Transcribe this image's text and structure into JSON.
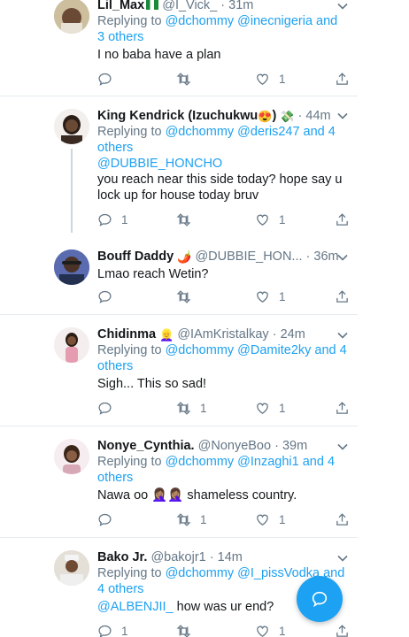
{
  "tweets": [
    {
      "name": "Lil_Max",
      "name_emoji": "🇳🇬",
      "handle": "@I_Vick_",
      "time": "31m",
      "reply_prefix": "Replying to ",
      "reply_links": "@dchommy @inecnigeria and 3 others",
      "mention": "",
      "text": "I no baba have a plan",
      "reply_count": "",
      "retweet_count": "",
      "like_count": "1"
    },
    {
      "name": "King Kendrick (Izuchukwu",
      "name_emoji": "😍",
      "name_suffix": ")",
      "name_emoji2": "💸",
      "handle": "",
      "time": "44m",
      "reply_prefix": "Replying to ",
      "reply_links": "@dchommy @deris247 and 4 others",
      "mention": "@DUBBIE_HONCHO",
      "text": "you reach near this side today? hope say u lock up for house today bruv",
      "reply_count": "1",
      "retweet_count": "",
      "like_count": "1"
    },
    {
      "name": "Bouff Daddy",
      "name_emoji": "🌶️",
      "handle": "@DUBBIE_HON...",
      "time": "36m",
      "text": "Lmao reach Wetin?",
      "reply_count": "",
      "retweet_count": "",
      "like_count": "1"
    },
    {
      "name": "Chidinma",
      "name_emoji": "👱‍♀️",
      "handle": "@IAmKristalkay",
      "time": "24m",
      "reply_prefix": "Replying to ",
      "reply_links": "@dchommy @Damite2ky and 4 others",
      "text": "Sigh... This so sad!",
      "reply_count": "",
      "retweet_count": "1",
      "like_count": "1"
    },
    {
      "name": "Nonye_Cynthia.",
      "handle": "@NonyeBoo",
      "time": "39m",
      "reply_prefix": "Replying to ",
      "reply_links": "@dchommy @Inzaghi1 and 4 others",
      "text": "Nawa oo 🤦🏽‍♀️🤦🏽‍♀️ shameless country.",
      "reply_count": "",
      "retweet_count": "1",
      "like_count": "1"
    },
    {
      "name": "Bako Jr.",
      "handle": "@bakojr1",
      "time": "14m",
      "reply_prefix": "Replying to ",
      "reply_links": "@dchommy @I_pissVodka and 4 others",
      "mention": "@ALBENJII_",
      "text": " how was ur end?",
      "reply_count": "1",
      "retweet_count": "",
      "like_count": "1"
    }
  ],
  "dot": "·",
  "icons": {
    "reply": "reply-icon",
    "retweet": "retweet-icon",
    "like": "like-icon",
    "share": "share-icon",
    "compose": "compose-reply-icon",
    "chevron": "chevron-down-icon"
  },
  "colors": {
    "accent": "#1da1f2",
    "muted": "#657786",
    "divider": "#e6ecf0"
  }
}
